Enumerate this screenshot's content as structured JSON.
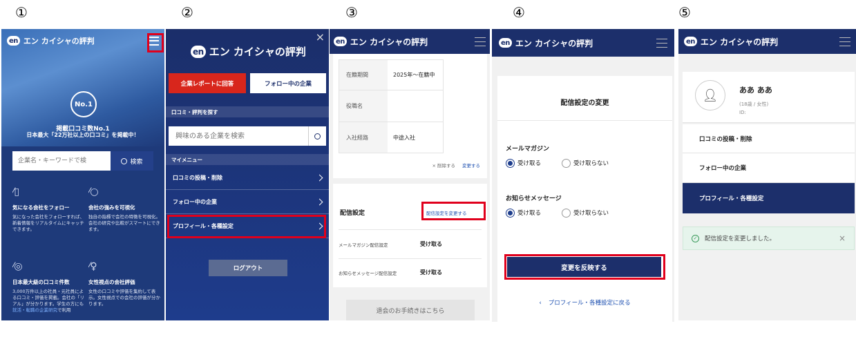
{
  "steps": [
    "①",
    "②",
    "③",
    "④",
    "⑤"
  ],
  "brand": {
    "badge": "en",
    "name": "エン カイシャの評判"
  },
  "p1": {
    "headline": "掲載口コミ数No.1",
    "headline2": "日本最大「22万社以上の口コミ」を掲載中！",
    "search_placeholder": "企業名・キーワードで検",
    "search_button": "検索",
    "no1": "No.1",
    "features": [
      {
        "title": "気になる会社をフォロー",
        "desc": "気になった会社をフォローすれば、新着情報をリアルタイムにキャッチできます。"
      },
      {
        "title": "会社の強みを可視化",
        "desc": "独自の指標で会社の特徴を可視化。会社の研究や比較がスマートにできます。"
      },
      {
        "title": "日本最大級の口コミ件数",
        "desc": "3,000万件以上の社員・元社員による口コミ・評価を掲載。会社の「リアル」が分かります。学生の方にも",
        "link": "就活・転職の企業研究",
        "tail": "で利用"
      },
      {
        "title": "女性視点の会社評価",
        "desc": "女性の口コミや評価を集約して表示。女性視点での会社の評価が分かります。"
      }
    ]
  },
  "p2": {
    "answer_btn": "企業レポートに回答",
    "follow_btn": "フォロー中の企業",
    "section_search": "口コミ・評判を探す",
    "search_placeholder": "興味のある企業を検索",
    "section_menu": "マイメニュー",
    "menu": [
      "口コミの投稿・削除",
      "フォロー中の企業",
      "プロフィール・各種設定"
    ],
    "logout": "ログアウト"
  },
  "p3": {
    "rows": [
      {
        "label": "在籍期間",
        "value": "2025年～在籍中"
      },
      {
        "label": "役職名",
        "value": ""
      },
      {
        "label": "入社経路",
        "value": "中途入社"
      }
    ],
    "delete_link": "× 削除する",
    "change_link": "変更する",
    "section_title": "配信設定",
    "change_setting_link": "配信設定を変更する",
    "settings": [
      {
        "label": "メールマガジン配信設定",
        "value": "受け取る"
      },
      {
        "label": "お知らせメッセージ配信設定",
        "value": "受け取る"
      }
    ],
    "withdraw": "退会のお手続きはこちら"
  },
  "p4": {
    "title": "配信設定の変更",
    "groups": [
      {
        "label": "メールマガジン",
        "on": "受け取る",
        "off": "受け取らない"
      },
      {
        "label": "お知らせメッセージ",
        "on": "受け取る",
        "off": "受け取らない"
      }
    ],
    "apply_btn": "変更を反映する",
    "back_link": "プロフィール・各種設定に戻る"
  },
  "p5": {
    "name": "ああ ああ",
    "meta": "(18歳 / 女性)",
    "id_label": "ID:",
    "menu": [
      "口コミの投稿・削除",
      "フォロー中の企業",
      "プロフィール・各種設定"
    ],
    "toast": "配信設定を変更しました。",
    "close": "×"
  },
  "colors": {
    "navy": "#1c2f6b",
    "red": "#e0001c",
    "success_bg": "#e6f4ec"
  }
}
